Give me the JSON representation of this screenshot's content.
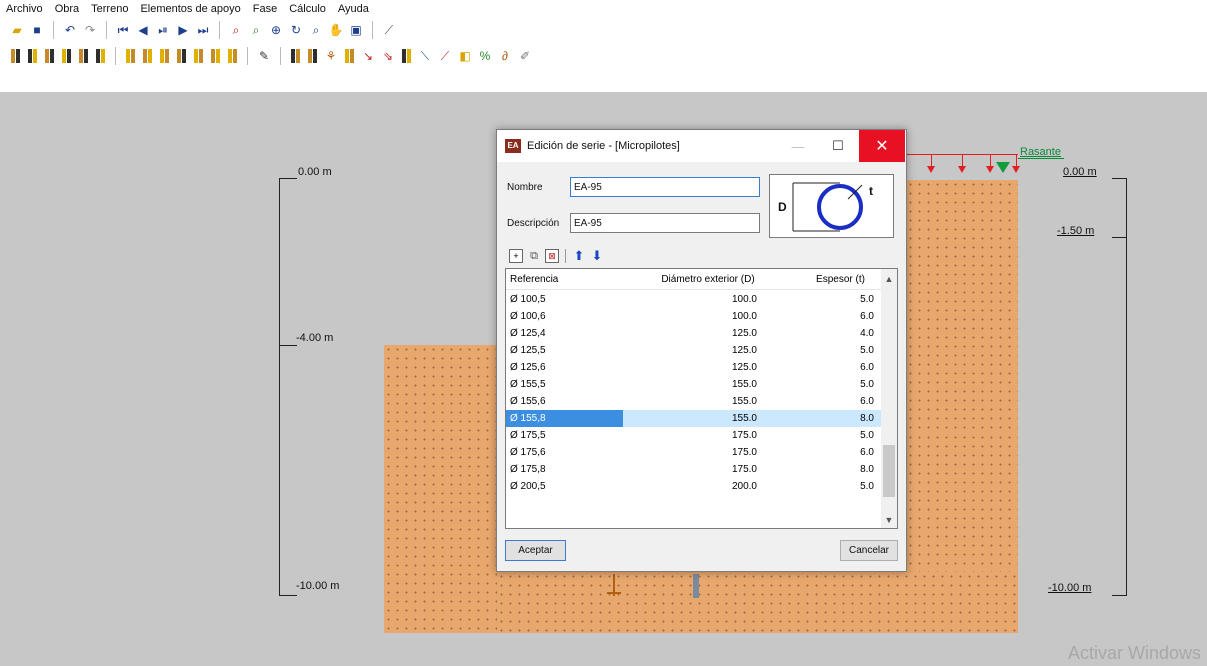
{
  "menu": [
    "Archivo",
    "Obra",
    "Terreno",
    "Elementos de apoyo",
    "Fase",
    "Cálculo",
    "Ayuda"
  ],
  "canvas": {
    "left_levels": [
      "0.00 m",
      "-4.00 m",
      "-10.00 m"
    ],
    "right_levels": [
      "0.00 m",
      "-1.50 m",
      "-10.00 m"
    ],
    "rasante_label": "Rasante",
    "watermark": "Activar Windows",
    "soil_color": "#e8a76d",
    "background_color": "#c7c7c7"
  },
  "dialog": {
    "title": "Edición de serie - [Micropilotes]",
    "icon_text": "EA",
    "nombre_label": "Nombre",
    "nombre_value": "EA-95",
    "descripcion_label": "Descripción",
    "descripcion_value": "EA-95",
    "preview": {
      "d_label": "D",
      "t_label": "t"
    },
    "columns": [
      "Referencia",
      "Diámetro exterior (D)",
      "Espesor (t)"
    ],
    "rows": [
      {
        "ref": "Ø 100,5",
        "d": "100.0",
        "t": "5.0",
        "selected": false
      },
      {
        "ref": "Ø 100,6",
        "d": "100.0",
        "t": "6.0",
        "selected": false
      },
      {
        "ref": "Ø 125,4",
        "d": "125.0",
        "t": "4.0",
        "selected": false
      },
      {
        "ref": "Ø 125,5",
        "d": "125.0",
        "t": "5.0",
        "selected": false
      },
      {
        "ref": "Ø 125,6",
        "d": "125.0",
        "t": "6.0",
        "selected": false
      },
      {
        "ref": "Ø 155,5",
        "d": "155.0",
        "t": "5.0",
        "selected": false
      },
      {
        "ref": "Ø 155,6",
        "d": "155.0",
        "t": "6.0",
        "selected": false
      },
      {
        "ref": "Ø 155,8",
        "d": "155.0",
        "t": "8.0",
        "selected": true
      },
      {
        "ref": "Ø 175,5",
        "d": "175.0",
        "t": "5.0",
        "selected": false
      },
      {
        "ref": "Ø 175,6",
        "d": "175.0",
        "t": "6.0",
        "selected": false
      },
      {
        "ref": "Ø 175,8",
        "d": "175.0",
        "t": "8.0",
        "selected": false
      },
      {
        "ref": "Ø 200,5",
        "d": "200.0",
        "t": "5.0",
        "selected": false
      }
    ],
    "accept_label": "Aceptar",
    "cancel_label": "Cancelar"
  }
}
